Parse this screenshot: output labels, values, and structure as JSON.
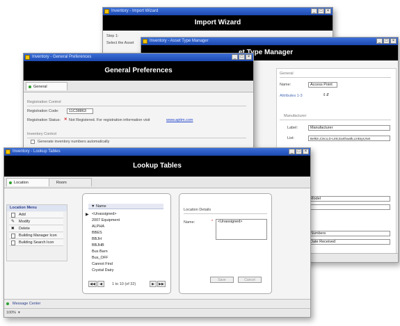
{
  "import_wizard": {
    "title": "Inventory - Import Wizard",
    "banner": "Import Wizard",
    "step": "Step 1:",
    "instruction": "Select the Asset"
  },
  "asset_type_manager": {
    "title": "Inventory - Asset Type Manager",
    "banner": "et Type Manager",
    "group_general": "General",
    "name_label": "Name:",
    "name_value": "Access Point",
    "attributes_label": "Attributes 1-3",
    "group_manufacturer": "Manufacturer",
    "col_label": "Label:",
    "col_label_value": "Manufacturer",
    "col_list": "List:",
    "col_list_value": "Belkin,Cisco,D-Link,Earthwalk,Linksys,Net",
    "model_value": "Model",
    "numbers_value": "Numbers",
    "date_value": "Date Received"
  },
  "general_prefs": {
    "title": "Inventory - General Preferences",
    "banner": "General Preferences",
    "tab_general": "General",
    "section_registration": "Registration Control",
    "reg_code_label": "Registration Code:",
    "reg_code_value": "11C38863",
    "reg_status_label": "Registration Status:",
    "reg_status_value": "Not Registered. For registration information visit",
    "reg_link": "www.aptim.com",
    "section_inventory": "Inventory Control",
    "checkbox_label": "Generate inventory numbers automatically"
  },
  "lookup": {
    "title": "Inventory - Lookup Tables",
    "banner": "Lookup Tables",
    "tabs": [
      "Location",
      "Room"
    ],
    "menu_header": "Location Menu",
    "menu": [
      {
        "label": "Add",
        "icon": "document-icon"
      },
      {
        "label": "Modify",
        "icon": "pencil-icon"
      },
      {
        "label": "Delete",
        "icon": "delete-icon"
      },
      {
        "label": "Building Manager Icon",
        "icon": "document-icon"
      },
      {
        "label": "Building Search Icon",
        "icon": "document-icon"
      }
    ],
    "list_header": "Name",
    "list_items": [
      "<Unassigned>",
      "2007 Equipment",
      "ALPHA",
      "BBES",
      "BBJH",
      "BBJHB",
      "Bus Barn",
      "Bus_OFF",
      "Cannot Find",
      "Crystal Dairy"
    ],
    "pager": "1 to 10 (of 32)",
    "details_header": "Location Details",
    "details_name_label": "Name:",
    "details_name_value": "<Unassigned>",
    "btn_save": "Save",
    "btn_cancel": "Cancel",
    "message_center": "Message Center",
    "zoom": "100%"
  }
}
